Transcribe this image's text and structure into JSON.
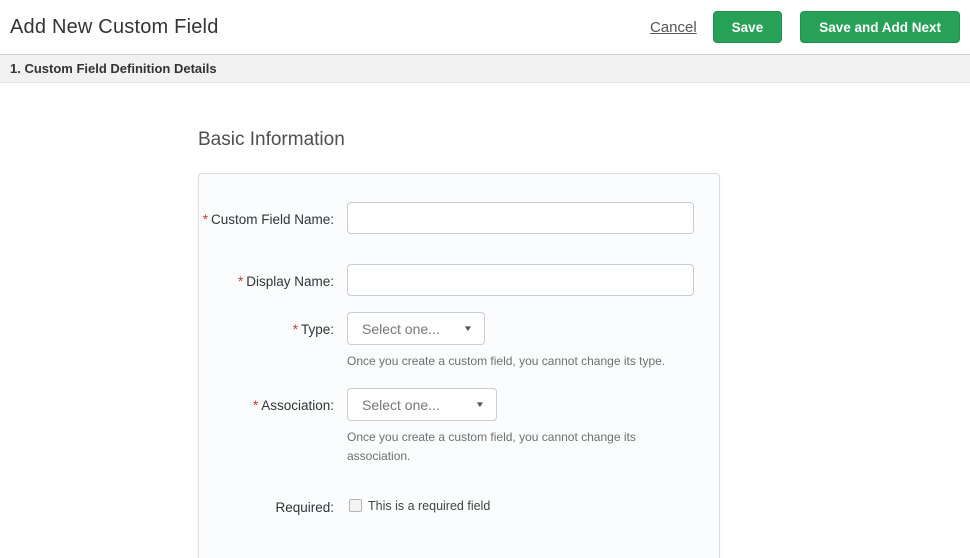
{
  "header": {
    "title": "Add New Custom Field",
    "cancel_label": "Cancel",
    "save_label": "Save",
    "save_add_next_label": "Save and Add Next"
  },
  "section": {
    "title": "1. Custom Field Definition Details"
  },
  "form": {
    "heading": "Basic Information",
    "required_marker": "*",
    "fields": {
      "custom_field_name": {
        "label": "Custom Field Name:",
        "value": "",
        "required": true
      },
      "display_name": {
        "label": "Display Name:",
        "value": "",
        "required": true
      },
      "type": {
        "label": "Type:",
        "selected_value": "Select one...",
        "help": "Once you create a custom field, you cannot change its type.",
        "required": true
      },
      "association": {
        "label": "Association:",
        "selected_value": "Select one...",
        "help": "Once you create a custom field, you cannot change its association.",
        "required": true
      },
      "required_field": {
        "label": "Required:",
        "checkbox_label": "This is a required field",
        "checked": false
      }
    }
  },
  "icons": {
    "dropdown_caret": "▼"
  },
  "colors": {
    "accent_green": "#28a158",
    "asterisk_red": "#c53b32",
    "section_bar_bg": "#f1f1f1"
  }
}
